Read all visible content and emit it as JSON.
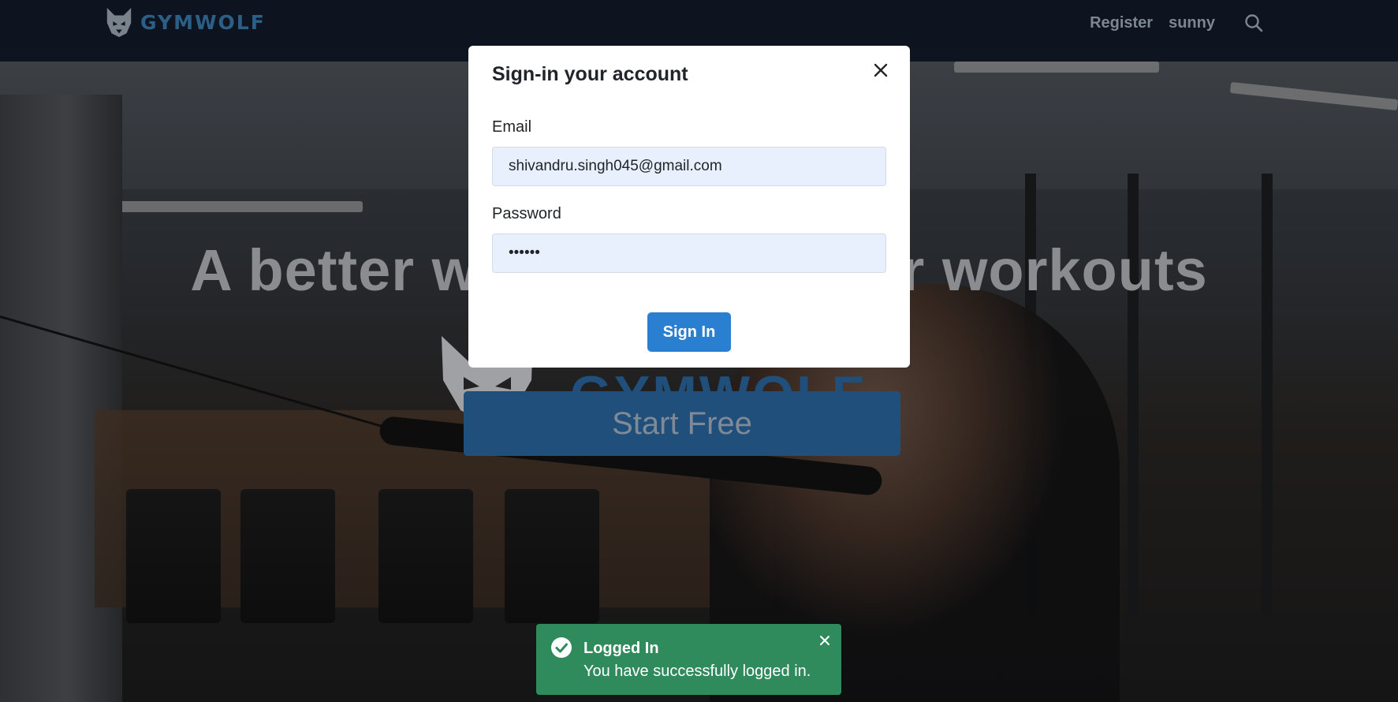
{
  "navbar": {
    "logo_text": "GYMWOLF",
    "links": {
      "register": "Register",
      "user": "sunny"
    },
    "icons": {
      "logo": "wolf-logo-icon",
      "search": "search-icon"
    }
  },
  "hero": {
    "title": "A better way to track your workouts",
    "brand_text": "GYMWOLF",
    "start_button": "Start Free"
  },
  "signin_modal": {
    "title": "Sign-in your account",
    "email": {
      "label": "Email",
      "value": "shivandru.singh045@gmail.com"
    },
    "password": {
      "label": "Password",
      "value": "••••••"
    },
    "submit_label": "Sign In",
    "close_icon": "close-icon"
  },
  "toast": {
    "title": "Logged In",
    "message": "You have successfully logged in.",
    "icon": "check-circle-icon",
    "close_icon": "close-icon"
  },
  "colors": {
    "navbar_bg": "#0b1320",
    "brand_blue": "#2b5f86",
    "primary_button": "#2b7fd0",
    "input_bg": "#e8f0fe",
    "toast_success": "#2f8a5c"
  }
}
